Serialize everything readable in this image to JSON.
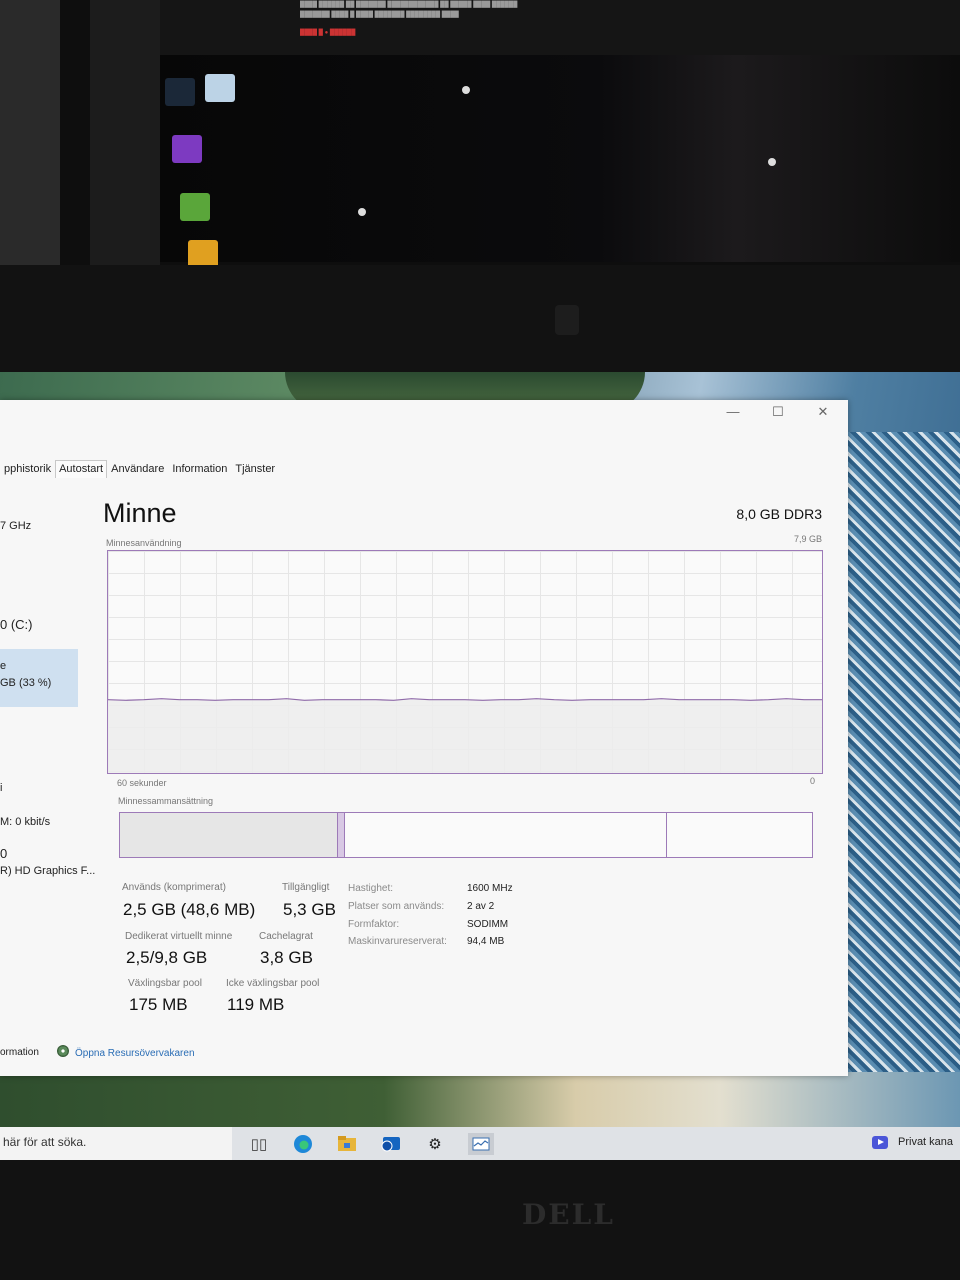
{
  "window": {
    "controls": {
      "minimize": "—",
      "maximize": "☐",
      "close": "✕"
    },
    "tabs": [
      {
        "label": "pphistorik",
        "active": false
      },
      {
        "label": "Autostart",
        "active": true
      },
      {
        "label": "Användare",
        "active": false
      },
      {
        "label": "Information",
        "active": false
      },
      {
        "label": "Tjänster",
        "active": false
      }
    ]
  },
  "sidebar": {
    "items": [
      {
        "text": "7 GHz"
      },
      {
        "text": "e"
      },
      {
        "text": "GB (33 %)"
      },
      {
        "text": "0 (C:)"
      },
      {
        "text": "i"
      },
      {
        "text": "M: 0 kbit/s"
      },
      {
        "text": "0"
      },
      {
        "text": "R) HD Graphics F..."
      }
    ]
  },
  "memory": {
    "title": "Minne",
    "total_spec": "8,0 GB DDR3",
    "usage_label": "Minnesanvändning",
    "max_label": "7,9 GB",
    "time_left": "60 sekunder",
    "time_right": "0",
    "composition_label": "Minnessammansättning",
    "usage_fraction": 0.33,
    "composition": [
      {
        "segment": "in-use",
        "fraction": 0.315
      },
      {
        "segment": "modified",
        "fraction": 0.01
      },
      {
        "segment": "standby",
        "fraction": 0.465
      },
      {
        "segment": "free",
        "fraction": 0.21
      }
    ]
  },
  "stats": {
    "in_use_label": "Används (komprimerat)",
    "in_use_value": "2,5 GB (48,6 MB)",
    "available_label": "Tillgängligt",
    "available_value": "5,3 GB",
    "committed_label": "Dedikerat virtuellt minne",
    "committed_value": "2,5/9,8 GB",
    "cached_label": "Cachelagrat",
    "cached_value": "3,8 GB",
    "paged_label": "Växlingsbar pool",
    "paged_value": "175 MB",
    "nonpaged_label": "Icke växlingsbar pool",
    "nonpaged_value": "119 MB"
  },
  "specs": [
    {
      "label": "Hastighet:",
      "value": "1600 MHz"
    },
    {
      "label": "Platser som används:",
      "value": "2 av 2"
    },
    {
      "label": "Formfaktor:",
      "value": "SODIMM"
    },
    {
      "label": "Maskinvarureserverat:",
      "value": "94,4 MB"
    }
  ],
  "footer": {
    "left": "ormation",
    "link": "Öppna Resursövervakaren"
  },
  "taskbar": {
    "search_text": "här för att söka.",
    "tray_text": "Privat kana"
  },
  "brand": "DELL",
  "colors": {
    "memory_purple": "#9d7ab8",
    "selected_bg": "#cfe0f0",
    "link_blue": "#2a6db5",
    "private_icon": "#4b56d8"
  }
}
